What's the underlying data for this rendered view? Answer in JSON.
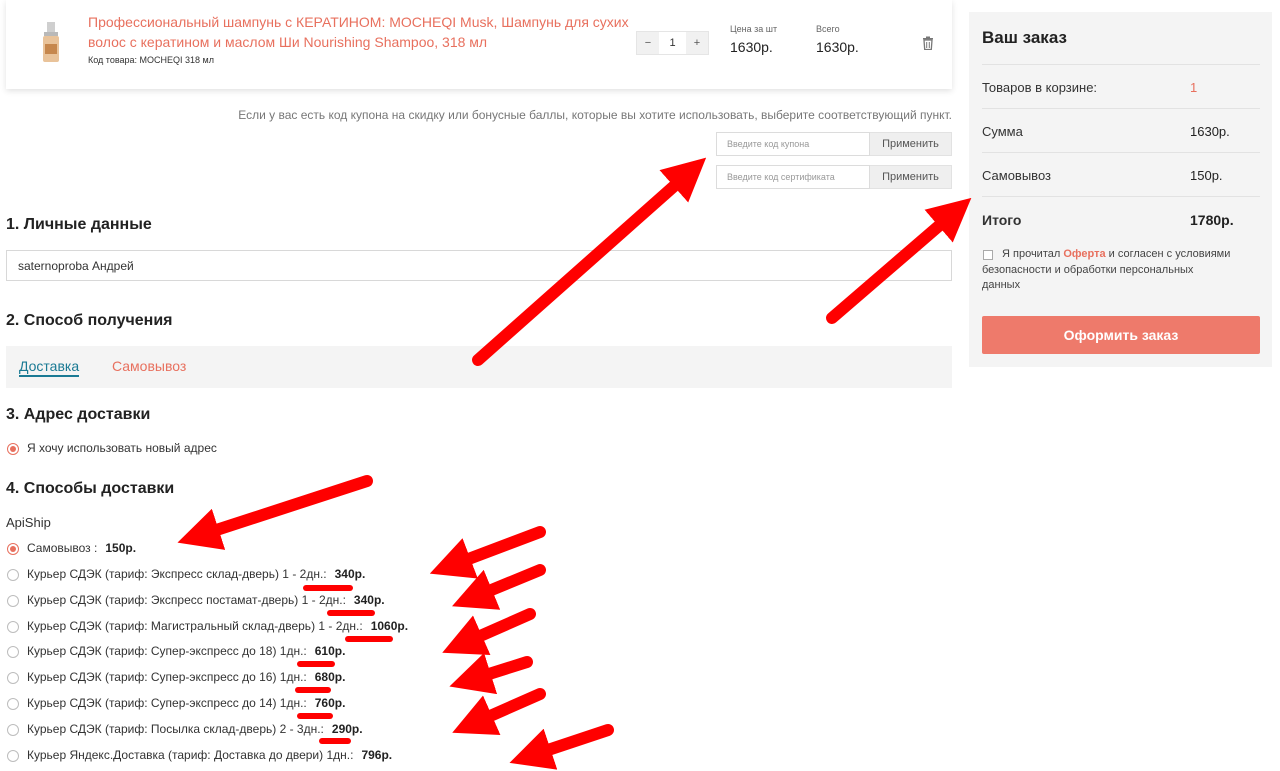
{
  "product": {
    "name": "Профессиональный шампунь с КЕРАТИНОМ: MOCHEQI Musk, Шампунь для сухих волос с кератином и маслом Ши Nourishing Shampoo, 318 мл",
    "code": "Код товара: MOCHEQI 318 мл",
    "qty_minus": "−",
    "qty_value": "1",
    "qty_plus": "+",
    "unit_price_label": "Цена за шт",
    "unit_price": "1630р.",
    "total_label": "Всего",
    "total": "1630р."
  },
  "coupon": {
    "hint": "Если у вас есть код купона на скидку или бонусные баллы, которые вы хотите использовать, выберите соответствующий пункт.",
    "coupon_placeholder": "Введите код купона",
    "certificate_placeholder": "Введите код сертификата",
    "apply_label": "Применить"
  },
  "sections": {
    "personal": "1. Личные данные",
    "method": "2. Способ получения",
    "address": "3. Адрес доставки",
    "delivery": "4. Способы доставки"
  },
  "personal": {
    "name_value": "saternoproba Андрей"
  },
  "method_tabs": [
    {
      "label": "Доставка",
      "active": true
    },
    {
      "label": "Самовывоз",
      "active": false
    }
  ],
  "address": {
    "option": "Я хочу использовать новый адрес"
  },
  "delivery": {
    "provider": "ApiShip",
    "options": [
      {
        "label": "Самовывоз :",
        "price": "150р.",
        "checked": true
      },
      {
        "label": "Курьер СДЭК (тариф: Экспресс склад-дверь) 1 - 2дн.:",
        "price": "340р.",
        "checked": false
      },
      {
        "label": "Курьер СДЭК (тариф: Экспресс постамат-дверь) 1 - 2дн.:",
        "price": "340р.",
        "checked": false
      },
      {
        "label": "Курьер СДЭК (тариф: Магистральный склад-дверь) 1 - 2дн.:",
        "price": "1060р.",
        "checked": false
      },
      {
        "label": "Курьер СДЭК (тариф: Супер-экспресс до 18) 1дн.:",
        "price": "610р.",
        "checked": false
      },
      {
        "label": "Курьер СДЭК (тариф: Супер-экспресс до 16) 1дн.:",
        "price": "680р.",
        "checked": false
      },
      {
        "label": "Курьер СДЭК (тариф: Супер-экспресс до 14) 1дн.:",
        "price": "760р.",
        "checked": false
      },
      {
        "label": "Курьер СДЭК (тариф: Посылка склад-дверь) 2 - 3дн.:",
        "price": "290р.",
        "checked": false
      },
      {
        "label": "Курьер Яндекс.Доставка (тариф: Доставка до двери) 1дн.:",
        "price": "796р.",
        "checked": false
      }
    ]
  },
  "summary": {
    "title": "Ваш заказ",
    "rows": [
      {
        "label": "Товаров в корзине:",
        "value": "1"
      },
      {
        "label": "Сумма",
        "value": "1630р."
      },
      {
        "label": "Самовывоз",
        "value": "150р."
      },
      {
        "label": "Итого",
        "value": "1780р."
      }
    ],
    "agree_prefix": "Я прочитал",
    "agree_link": "Оферта",
    "agree_suffix": "и согласен с условиями безопасности и обработки персональных данных",
    "order_button": "Оформить заказ"
  },
  "colors": {
    "accent": "#e8705e",
    "button": "#ee7a6b",
    "active_tab": "#1a7a94",
    "annotation": "#ff0000"
  }
}
